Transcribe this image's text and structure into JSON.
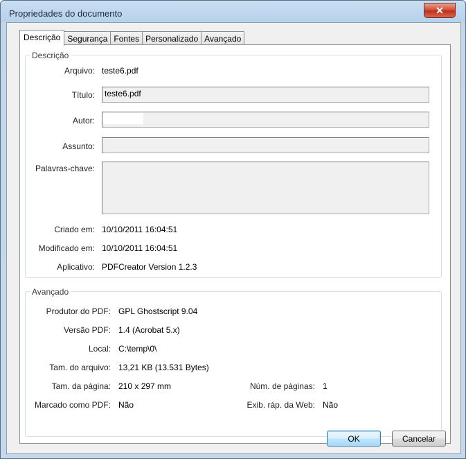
{
  "window": {
    "title": "Propriedades do documento",
    "close_symbol": "✕"
  },
  "tabs": [
    {
      "label": "Descrição",
      "active": true
    },
    {
      "label": "Segurança"
    },
    {
      "label": "Fontes"
    },
    {
      "label": "Personalizado"
    },
    {
      "label": "Avançado"
    }
  ],
  "description": {
    "group_title": "Descrição",
    "file_label": "Arquivo:",
    "file_value": "teste6.pdf",
    "title_label": "Título:",
    "title_value": "teste6.pdf",
    "author_label": "Autor:",
    "author_value": "",
    "subject_label": "Assunto:",
    "subject_value": "",
    "keywords_label": "Palavras-chave:",
    "keywords_value": "",
    "created_label": "Criado em:",
    "created_value": "10/10/2011 16:04:51",
    "modified_label": "Modificado em:",
    "modified_value": "10/10/2011 16:04:51",
    "application_label": "Aplicativo:",
    "application_value": "PDFCreator Version 1.2.3"
  },
  "advanced": {
    "group_title": "Avançado",
    "producer_label": "Produtor do PDF:",
    "producer_value": "GPL Ghostscript 9.04",
    "version_label": "Versão PDF:",
    "version_value": "1.4 (Acrobat 5.x)",
    "location_label": "Local:",
    "location_value": "C:\\temp\\0\\",
    "filesize_label": "Tam. do arquivo:",
    "filesize_value": "13,21 KB (13.531 Bytes)",
    "pagesize_label": "Tam. da página:",
    "pagesize_value": "210 x 297 mm",
    "pages_label": "Núm. de páginas:",
    "pages_value": "1",
    "tagged_label": "Marcado como PDF:",
    "tagged_value": "Não",
    "fastweb_label": "Exib. ráp. da Web:",
    "fastweb_value": "Não"
  },
  "buttons": {
    "ok": "OK",
    "cancel": "Cancelar"
  }
}
